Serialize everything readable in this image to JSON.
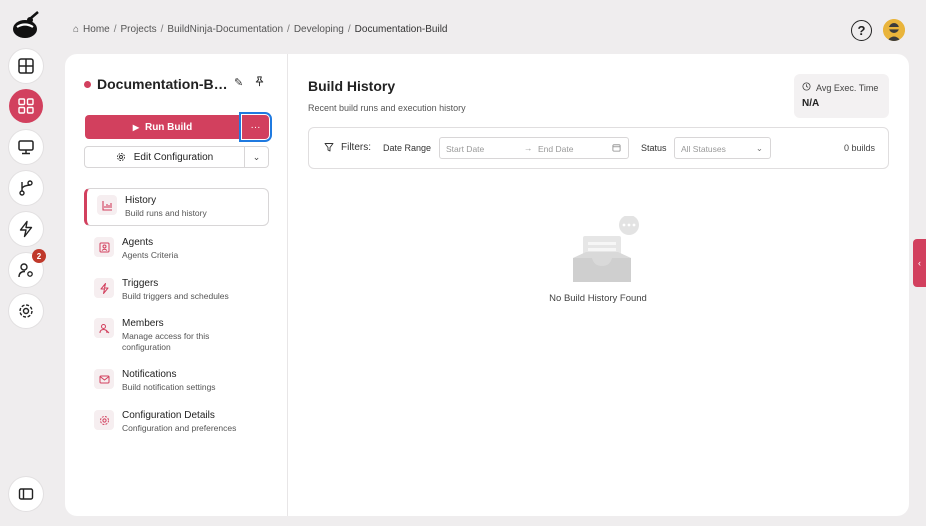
{
  "breadcrumb": {
    "items": [
      "Home",
      "Projects",
      "BuildNinja-Documentation",
      "Developing",
      "Documentation-Build"
    ],
    "separator": "/"
  },
  "rail": {
    "items": [
      {
        "name": "dashboard",
        "icon": "layout-grid-icon"
      },
      {
        "name": "projects",
        "icon": "apps-grid-icon",
        "active": true
      },
      {
        "name": "agents",
        "icon": "monitor-icon"
      },
      {
        "name": "vcs",
        "icon": "git-branch-icon"
      },
      {
        "name": "triggers",
        "icon": "lightning-icon"
      },
      {
        "name": "users",
        "icon": "user-settings-icon",
        "badge": "2"
      },
      {
        "name": "settings",
        "icon": "gear-icon"
      }
    ],
    "collapse_icon": "sidebar-toggle-icon"
  },
  "header": {
    "help_label": "?"
  },
  "config": {
    "title": "Documentation-Build",
    "run_build_label": "Run Build",
    "more_label": "···",
    "edit_config_label": "Edit Configuration",
    "nav": [
      {
        "title": "History",
        "subtitle": "Build runs and history",
        "icon": "chart-icon",
        "active": true
      },
      {
        "title": "Agents",
        "subtitle": "Agents Criteria",
        "icon": "agent-icon"
      },
      {
        "title": "Triggers",
        "subtitle": "Build triggers and schedules",
        "icon": "lightning-icon"
      },
      {
        "title": "Members",
        "subtitle": "Manage access for this configuration",
        "icon": "members-icon"
      },
      {
        "title": "Notifications",
        "subtitle": "Build notification settings",
        "icon": "mail-icon"
      },
      {
        "title": "Configuration Details",
        "subtitle": "Configuration and preferences",
        "icon": "gear-icon"
      }
    ]
  },
  "history": {
    "title": "Build History",
    "subtitle": "Recent build runs and execution history",
    "avg_exec_label": "Avg Exec. Time",
    "avg_exec_value": "N/A",
    "filters_label": "Filters:",
    "date_range_label": "Date Range",
    "start_placeholder": "Start Date",
    "arrow": "→",
    "end_placeholder": "End Date",
    "status_label": "Status",
    "status_value": "All Statuses",
    "build_count": "0 builds",
    "empty_text": "No Build History Found"
  },
  "colors": {
    "accent": "#d2405e",
    "focus": "#1f7ae0",
    "background": "#efedee"
  }
}
